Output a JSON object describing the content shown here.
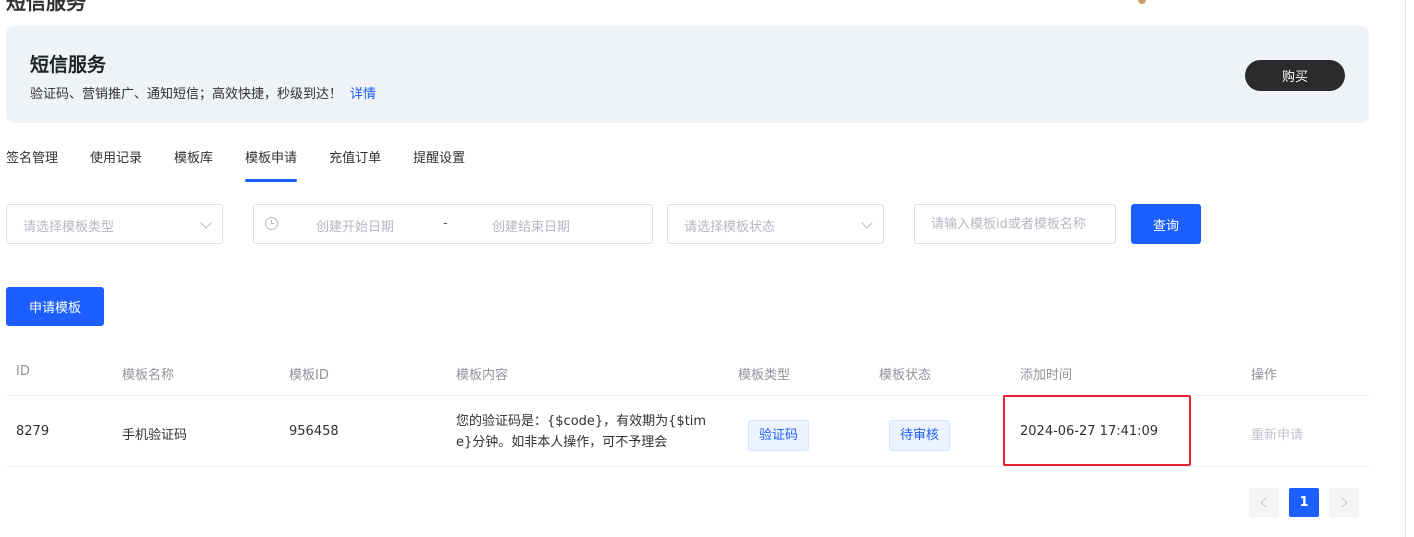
{
  "page": {
    "title": "短信服务"
  },
  "banner": {
    "title": "短信服务",
    "description": "验证码、营销推广、通知短信；高效快捷，秒级到达！",
    "link_label": "详情",
    "buy_label": "购买"
  },
  "tabs": [
    {
      "label": "签名管理"
    },
    {
      "label": "使用记录"
    },
    {
      "label": "模板库"
    },
    {
      "label": "模板申请",
      "active": true
    },
    {
      "label": "充值订单"
    },
    {
      "label": "提醒设置"
    }
  ],
  "filters": {
    "type_placeholder": "请选择模板类型",
    "date_start_placeholder": "创建开始日期",
    "date_separator": "-",
    "date_end_placeholder": "创建结束日期",
    "status_placeholder": "请选择模板状态",
    "search_placeholder": "请输入模板id或者模板名称",
    "query_label": "查询"
  },
  "actions": {
    "apply_label": "申请模板"
  },
  "table": {
    "headers": [
      "ID",
      "模板名称",
      "模板ID",
      "模板内容",
      "模板类型",
      "模板状态",
      "添加时间",
      "操作"
    ],
    "rows": [
      {
        "id": "8279",
        "name": "手机验证码",
        "template_id": "956458",
        "content": "您的验证码是：{$code}，有效期为{$time}分钟。如非本人操作，可不予理会",
        "type": "验证码",
        "status": "待审核",
        "added_time": "2024-06-27 17:41:09",
        "action": "重新申请"
      }
    ]
  },
  "pagination": {
    "current_page": "1"
  },
  "colors": {
    "primary": "#1d5eff",
    "banner_bg": "#eff2f7",
    "buy_button": "#2b2b2b",
    "highlight": "#e0262e"
  }
}
